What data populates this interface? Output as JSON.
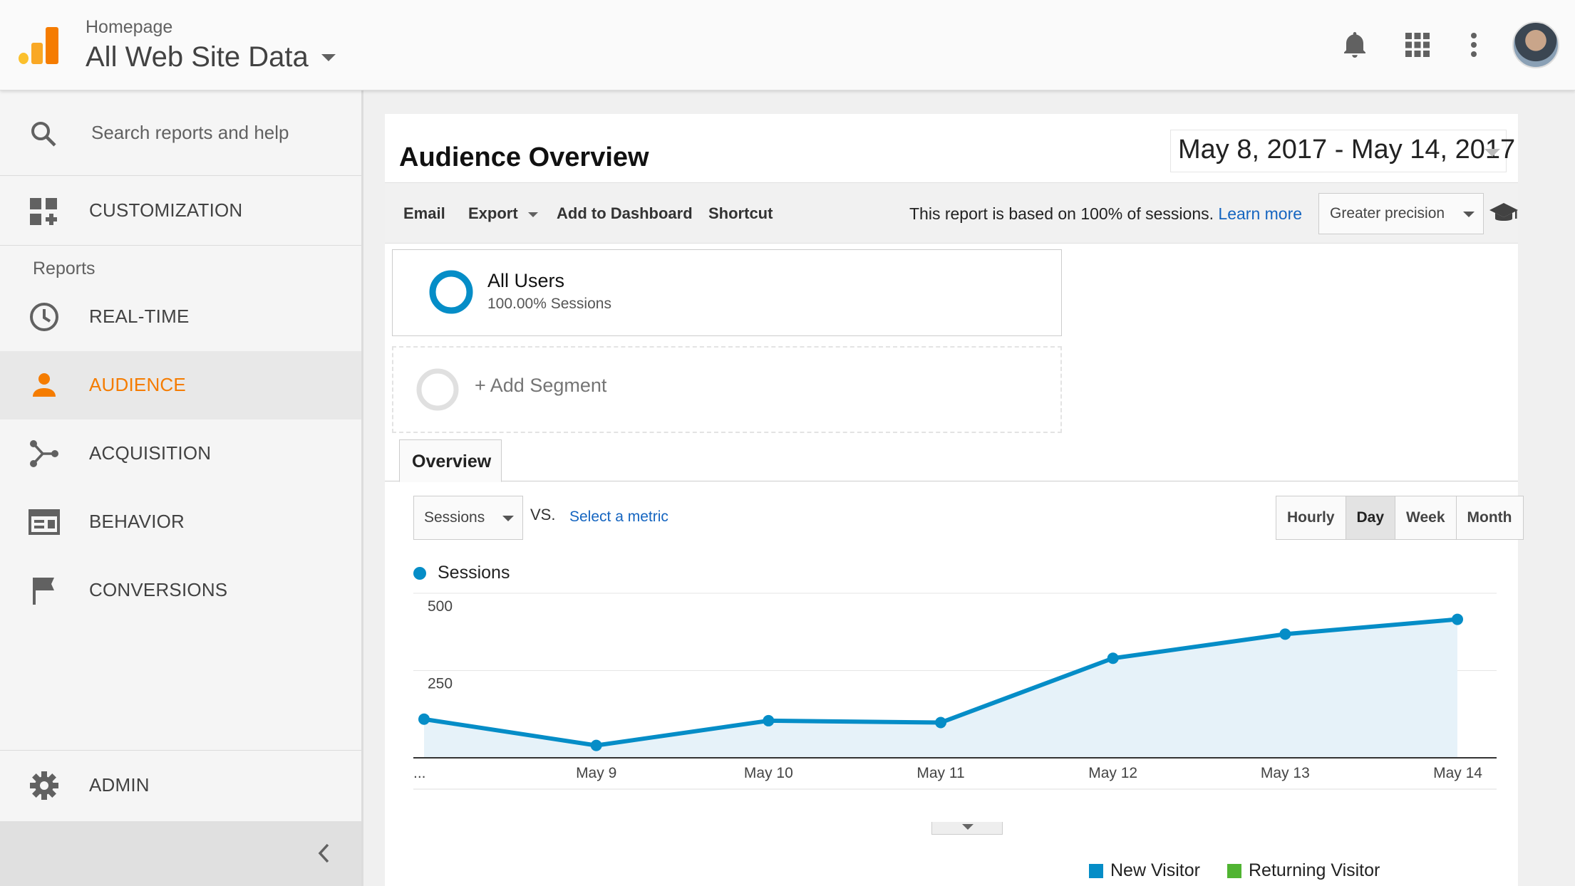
{
  "header": {
    "breadcrumb": "Homepage",
    "property_name": "All Web Site Data",
    "icons": [
      "bell-icon",
      "apps-grid-icon",
      "more-vert-icon",
      "user-avatar"
    ]
  },
  "sidebar": {
    "search_placeholder": "Search reports and help",
    "customization_label": "CUSTOMIZATION",
    "reports_heading": "Reports",
    "items": [
      {
        "label": "REAL-TIME",
        "icon": "clock-icon"
      },
      {
        "label": "AUDIENCE",
        "icon": "person-icon",
        "active": true
      },
      {
        "label": "ACQUISITION",
        "icon": "acquisition-icon"
      },
      {
        "label": "BEHAVIOR",
        "icon": "behavior-icon"
      },
      {
        "label": "CONVERSIONS",
        "icon": "flag-icon"
      }
    ],
    "admin_label": "ADMIN"
  },
  "report": {
    "title": "Audience Overview",
    "date_range": "May 8, 2017 - May 14, 2017"
  },
  "toolbar": {
    "email": "Email",
    "export": "Export",
    "add_to_dashboard": "Add to Dashboard",
    "shortcut": "Shortcut",
    "sampling_note": "This report is based on 100% of sessions.",
    "learn_more": "Learn more",
    "precision_value": "Greater precision"
  },
  "segments": {
    "primary_name": "All Users",
    "primary_sub": "100.00% Sessions",
    "add_label": "+ Add Segment"
  },
  "tabs": {
    "overview": "Overview"
  },
  "metric_controls": {
    "metric": "Sessions",
    "vs": "VS.",
    "select_metric": "Select a metric",
    "periods": [
      "Hourly",
      "Day",
      "Week",
      "Month"
    ],
    "selected_period": "Day"
  },
  "chart_data": {
    "type": "area",
    "series": [
      {
        "name": "Sessions",
        "color": "#058dc7",
        "values": [
          125,
          40,
          120,
          114,
          322,
          400,
          448
        ]
      }
    ],
    "x_tick_labels": [
      "...",
      "May 9",
      "May 10",
      "May 11",
      "May 12",
      "May 13",
      "May 14"
    ],
    "y_ticks": [
      {
        "value": 500,
        "label": "500"
      },
      {
        "value": 250,
        "label": "250"
      }
    ],
    "ylim": [
      0,
      500
    ],
    "legend": "Sessions",
    "grid": true
  },
  "visitor_legend": [
    {
      "label": "New Visitor",
      "color": "#058dc7"
    },
    {
      "label": "Returning Visitor",
      "color": "#50b432"
    }
  ]
}
